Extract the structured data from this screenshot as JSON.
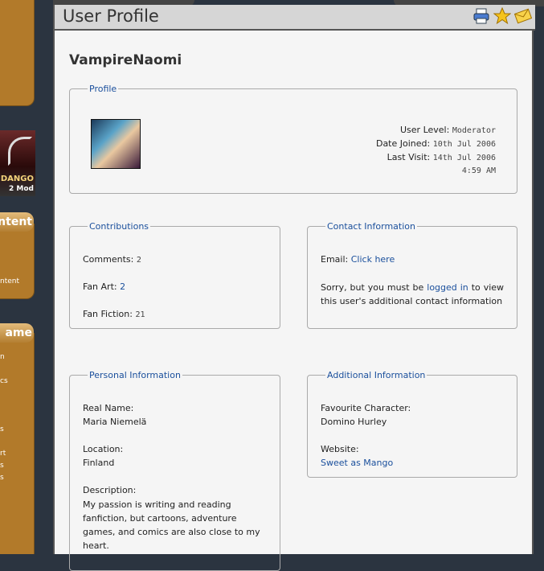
{
  "sidebar": {
    "header1": "ntent",
    "link1": "ntent",
    "header2": "ame",
    "links": [
      "n",
      "cs",
      "s",
      "rt",
      "s",
      "s"
    ],
    "banner_line1": "DANGO",
    "banner_line2": "2 Mod"
  },
  "page": {
    "title": "User Profile",
    "icons": [
      "printer-icon",
      "star-icon",
      "envelope-icon"
    ]
  },
  "user": {
    "name": "VampireNaomi"
  },
  "profile": {
    "legend": "Profile",
    "user_level_label": "User Level:",
    "user_level": "Moderator",
    "date_joined_label": "Date Joined:",
    "date_joined": "10th Jul 2006",
    "last_visit_label": "Last Visit:",
    "last_visit": "14th Jul 2006",
    "last_visit_time": "4:59 AM"
  },
  "contributions": {
    "legend": "Contributions",
    "comments_label": "Comments:",
    "comments": "2",
    "fanart_label": "Fan Art:",
    "fanart": "2",
    "fanfiction_label": "Fan Fiction:",
    "fanfiction": "21"
  },
  "contact": {
    "legend": "Contact Information",
    "email_label": "Email:",
    "email_link": "Click here",
    "sorry_pre": "Sorry, but you must be",
    "logged_in_link": "logged in",
    "sorry_post": "to view this user's additional contact information"
  },
  "personal": {
    "legend": "Personal Information",
    "real_name_label": "Real Name:",
    "real_name": "Maria Niemelä",
    "location_label": "Location:",
    "location": "Finland",
    "description_label": "Description:",
    "description": "My passion is writing and reading fanfiction, but cartoons, adventure games, and comics are also close to my heart."
  },
  "additional": {
    "legend": "Additional Information",
    "fav_char_label": "Favourite Character:",
    "fav_char": "Domino Hurley",
    "website_label": "Website:",
    "website_link": "Sweet as Mango"
  }
}
